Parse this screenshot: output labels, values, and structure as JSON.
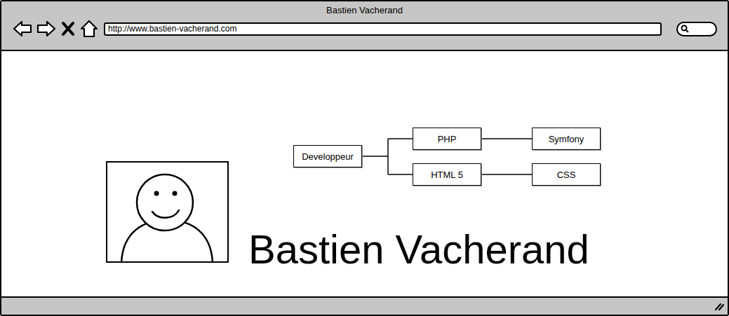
{
  "window": {
    "title": "Bastien Vacherand"
  },
  "address_bar": {
    "url": "http://www.bastien-vacherand.com"
  },
  "diagram": {
    "root": "Developpeur",
    "branches": [
      {
        "label": "PHP",
        "child": "Symfony"
      },
      {
        "label": "HTML 5",
        "child": "CSS"
      }
    ]
  },
  "profile": {
    "name": "Bastien Vacherand"
  }
}
